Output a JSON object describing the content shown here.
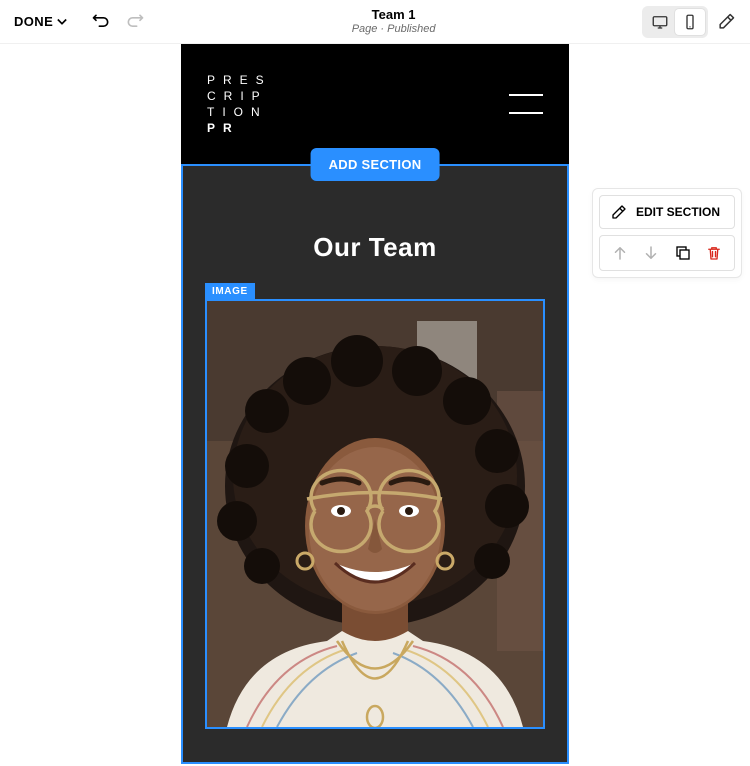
{
  "toolbar": {
    "done_label": "DONE",
    "page_title": "Team 1",
    "page_subtitle": "Page · Published"
  },
  "buttons": {
    "add_section": "ADD SECTION",
    "edit_section": "EDIT SECTION"
  },
  "section": {
    "heading": "Our Team",
    "image_block_label": "IMAGE"
  },
  "logo": {
    "line1": "PRES",
    "line2": "CRIP",
    "line3": "TION",
    "line4": "PR"
  },
  "colors": {
    "selection_blue": "#2a8fff",
    "dark_section": "#2b2b2b",
    "delete_red": "#d9281c"
  }
}
